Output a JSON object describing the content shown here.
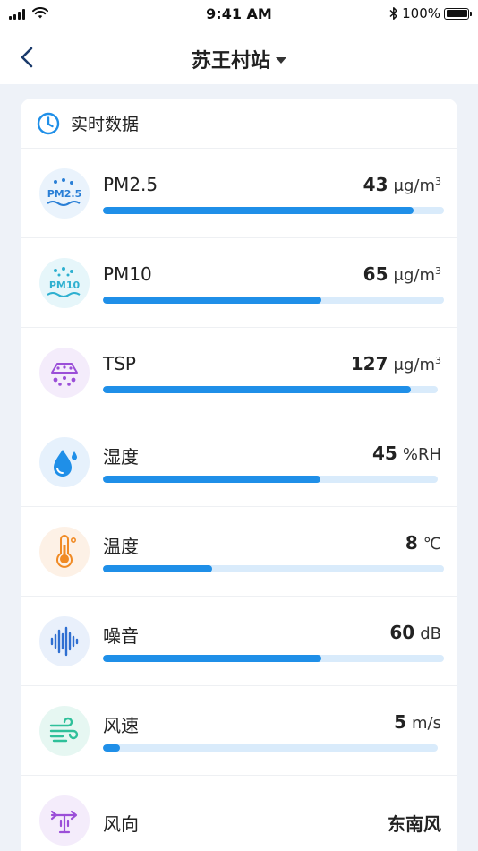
{
  "status": {
    "time": "9:41 AM",
    "battery": "100%"
  },
  "nav": {
    "title": "苏王村站"
  },
  "card": {
    "title": "实时数据"
  },
  "rows": [
    {
      "name": "PM2.5",
      "value": "43",
      "unit_base": "μg/m",
      "unit_sup": "3",
      "level": 0.91,
      "icon": "pm25-icon",
      "icon_bg": "#eaf3fc",
      "icon_text": "PM2.5",
      "icon_color": "#2a7fd6"
    },
    {
      "name": "PM10",
      "value": "65",
      "unit_base": "μg/m",
      "unit_sup": "3",
      "level": 0.64,
      "icon": "pm10-icon",
      "icon_bg": "#e6f6fa",
      "icon_text": "PM10",
      "icon_color": "#2eb0d0"
    },
    {
      "name": "TSP",
      "value": "127",
      "unit_base": "μg/m",
      "unit_sup": "3",
      "level": 0.92,
      "icon": "tsp-icon",
      "icon_bg": "#f4ecfb",
      "icon_color": "#9b4fd8"
    },
    {
      "name": "湿度",
      "value": "45",
      "unit_base": "%RH",
      "level": 0.65,
      "icon": "humidity-drop-icon",
      "icon_bg": "#e6f1fc",
      "icon_color": "#1f8fe8"
    },
    {
      "name": "温度",
      "value": "8",
      "unit_base": "℃",
      "level": 0.32,
      "icon": "thermometer-icon",
      "icon_bg": "#fdf1e6",
      "icon_color": "#f08a24"
    },
    {
      "name": "噪音",
      "value": "60",
      "unit_base": "dB",
      "level": 0.64,
      "icon": "sound-wave-icon",
      "icon_bg": "#e9f0fb",
      "icon_color": "#2f6fd1"
    },
    {
      "name": "风速",
      "value": "5",
      "unit_base": "m/s",
      "level": 0.05,
      "icon": "wind-icon",
      "icon_bg": "#e6f7f2",
      "icon_color": "#2fc09a"
    },
    {
      "name": "风向",
      "value": "东南风",
      "icon": "wind-vane-icon",
      "icon_bg": "#f4ecfb",
      "icon_color": "#9b4fd8"
    }
  ],
  "colors": {
    "bar_fill": "#1f8fe8",
    "bar_track": "#d9ebfb",
    "accent": "#1f8fe8"
  }
}
